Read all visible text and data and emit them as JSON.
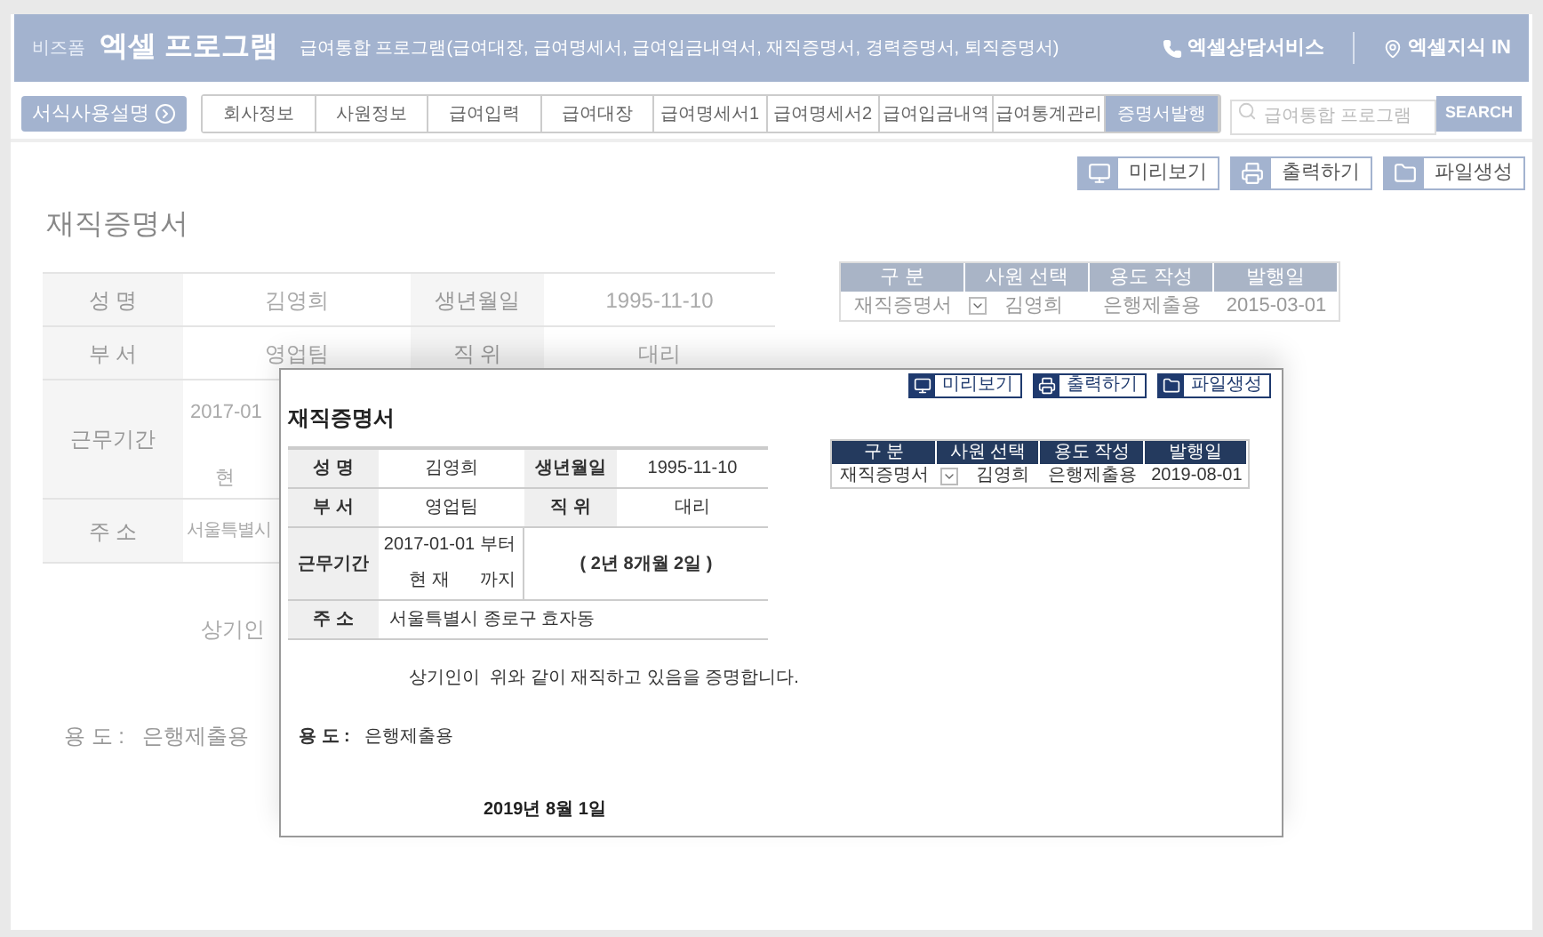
{
  "header": {
    "brand_small": "비즈폼",
    "brand": "엑셀 프로그램",
    "subtitle": "급여통합 프로그램(급여대장, 급여명세서, 급여입금내역서, 재직증명서, 경력증명서, 퇴직증명서)",
    "links": [
      {
        "kind": "phone",
        "label": "엑셀상담서비스"
      },
      {
        "kind": "pin",
        "label": "엑셀지식 IN"
      }
    ]
  },
  "nav": {
    "guide_button": "서식사용설명",
    "tabs": [
      {
        "label": "회사정보",
        "selected": false
      },
      {
        "label": "사원정보",
        "selected": false
      },
      {
        "label": "급여입력",
        "selected": false
      },
      {
        "label": "급여대장",
        "selected": false
      },
      {
        "label": "급여명세서1",
        "selected": false
      },
      {
        "label": "급여명세서2",
        "selected": false
      },
      {
        "label": "급여입금내역",
        "selected": false
      },
      {
        "label": "급여통계관리",
        "selected": false
      },
      {
        "label": "증명서발행",
        "selected": true
      }
    ],
    "search": {
      "placeholder": "급여통합 프로그램",
      "button": "SEARCH"
    }
  },
  "actions": [
    {
      "kind": "preview",
      "label": "미리보기"
    },
    {
      "kind": "print",
      "label": "출력하기"
    },
    {
      "kind": "file",
      "label": "파일생성"
    }
  ],
  "form": {
    "title": "재직증명서",
    "name_label": "성 명",
    "name": "김영희",
    "birth_label": "생년월일",
    "birth": "1995-11-10",
    "dept_label": "부 서",
    "dept": "영업팀",
    "position_label": "직 위",
    "position": "대리",
    "period_label": "근무기간",
    "start": "2017-01",
    "end": "현",
    "address_label": "주 소",
    "address": "서울특별시",
    "statement": "상기인",
    "purpose_label": "용 도 :",
    "purpose": "은행제출용"
  },
  "selector": {
    "columns": [
      "구 분",
      "사원 선택",
      "용도 작성",
      "발행일"
    ],
    "row": {
      "type": "재직증명서",
      "employee": "김영희",
      "purpose": "은행제출용",
      "date": "2015-03-01"
    }
  },
  "popup": {
    "actions": [
      {
        "kind": "preview",
        "label": "미리보기"
      },
      {
        "kind": "print",
        "label": "출력하기"
      },
      {
        "kind": "file",
        "label": "파일생성"
      }
    ],
    "form": {
      "title": "재직증명서",
      "name_label": "성 명",
      "name": "김영희",
      "birth_label": "생년월일",
      "birth": "1995-11-10",
      "dept_label": "부 서",
      "dept": "영업팀",
      "position_label": "직 위",
      "position": "대리",
      "period_label": "근무기간",
      "start": "2017-01-01",
      "start_suffix": "부터",
      "end": "현 재",
      "end_suffix": "까지",
      "duration": "( 2년 8개월 2일 )",
      "address_label": "주 소",
      "address": "서울특별시 종로구 효자동",
      "statement": "상기인이  위와 같이 재직하고 있음을 증명합니다.",
      "purpose_label": "용 도 :",
      "purpose": "은행제출용",
      "date": "2019년 8월 1일"
    },
    "selector": {
      "columns": [
        "구 분",
        "사원 선택",
        "용도 작성",
        "발행일"
      ],
      "row": {
        "type": "재직증명서",
        "employee": "김영희",
        "purpose": "은행제출용",
        "date": "2019-08-01"
      }
    }
  }
}
